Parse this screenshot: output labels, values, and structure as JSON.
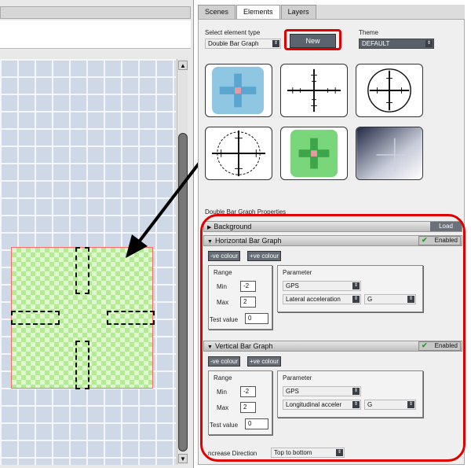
{
  "tabs": [
    {
      "label": "Scenes",
      "active": false
    },
    {
      "label": "Elements",
      "active": true
    },
    {
      "label": "Layers",
      "active": false
    }
  ],
  "element_selector": {
    "label": "Select element type",
    "value": "Double Bar Graph",
    "new_button": "New"
  },
  "theme": {
    "label": "Theme",
    "value": "DEFAULT"
  },
  "thumbnails": [
    {
      "style": "blue"
    },
    {
      "style": "ruler-white"
    },
    {
      "style": "circle-white"
    },
    {
      "style": "circle-dashed"
    },
    {
      "style": "green"
    },
    {
      "style": "gradient"
    }
  ],
  "properties": {
    "title": "Double Bar Graph Properties",
    "background": {
      "label": "Background",
      "load": "Load"
    },
    "horizontal": {
      "title": "Horizontal Bar Graph",
      "enabled": "Enabled",
      "neg_colour": "-ve colour",
      "pos_colour": "+ve colour",
      "range_label": "Range",
      "min_label": "Min",
      "min_value": "-2",
      "max_label": "Max",
      "max_value": "2",
      "test_label": "Test value",
      "test_value": "0",
      "parameter_label": "Parameter",
      "source": "GPS",
      "channel": "Lateral acceleration",
      "unit": "G"
    },
    "vertical": {
      "title": "Vertical Bar Graph",
      "enabled": "Enabled",
      "neg_colour": "-ve colour",
      "pos_colour": "+ve colour",
      "range_label": "Range",
      "min_label": "Min",
      "min_value": "-2",
      "max_label": "Max",
      "max_value": "2",
      "test_label": "Test value",
      "test_value": "0",
      "parameter_label": "Parameter",
      "source": "GPS",
      "channel": "Longitudinal acceler",
      "unit": "G"
    },
    "direction": {
      "label": "ncrease Direction",
      "value": "Top to bottom"
    }
  },
  "colors": {
    "highlight": "#e10000",
    "accent_dark": "#5b646e",
    "widget_green": "#b3eb93",
    "check_green": "#2a9a28"
  }
}
